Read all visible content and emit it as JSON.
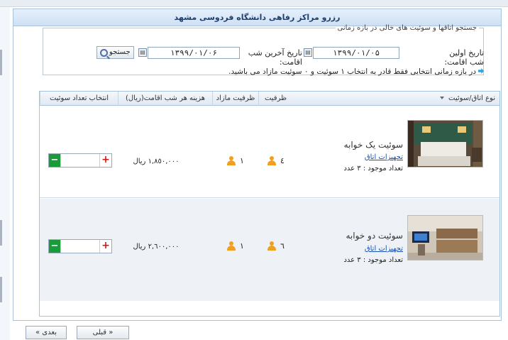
{
  "header": {
    "title": "رزرو مراکز رفاهی دانشگاه فردوسی مشهد"
  },
  "search": {
    "legend": "جستجو اتاقها و سوئیت های خالی در بازه زمانی",
    "first_label": "تاریخ اولین شب اقامت:",
    "first_value": "۱۳۹۹/۰۱/۰۵",
    "last_label": "تاریخ آخرین شب اقامت:",
    "last_value": "۱۳۹۹/۰۱/۰۶",
    "button_label": "جستجو",
    "note": "در بازه زمانی انتخابی فقط قادر به انتخاب ۱ سوئیت و ۰ سوئیت مازاد می باشید."
  },
  "grid": {
    "columns": {
      "type": "نوع اتاق/سوئیت",
      "capacity": "ظرفیت",
      "extra_capacity": "ظرفیت مازاد",
      "price": "هزینه هر شب اقامت(ریال)",
      "select": "انتخاب تعداد سوئیت"
    },
    "rows": [
      {
        "title": "سوئیت یک خوابه",
        "equipment_link": "تجهیزات اتاق",
        "count": "تعداد موجود : ۳ عدد",
        "capacity": "٤",
        "extra_capacity": "١",
        "price": "١,٨٥٠,٠٠٠ ريال",
        "quantity": ""
      },
      {
        "title": "سوئیت دو خوابه",
        "equipment_link": "تجهیزات اتاق",
        "count": "تعداد موجود : ۳ عدد",
        "capacity": "٦",
        "extra_capacity": "١",
        "price": "٢,٦٠٠,٠٠٠ ريال",
        "quantity": ""
      }
    ]
  },
  "nav": {
    "prev": "« قبلی",
    "next": "بعدی »"
  },
  "icons": {
    "calendar": "calendar-icon",
    "search": "search-icon",
    "info": "info-arrow-icon",
    "person": "person-icon",
    "minus": "minus-icon",
    "plus": "plus-icon"
  },
  "colors": {
    "accent": "#1a9a3a",
    "danger": "#d01818",
    "person": "#f0a020",
    "header": "#cfe0f4"
  }
}
